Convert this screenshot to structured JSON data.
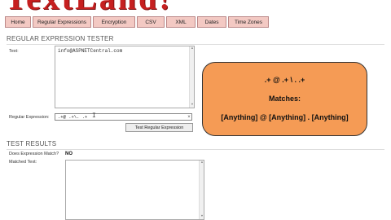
{
  "logo": {
    "text": "TextLand!"
  },
  "nav": [
    "Home",
    "Regular Expressions",
    "Encryption",
    "CSV",
    "XML",
    "Dates",
    "Time Zones"
  ],
  "tester": {
    "title": "REGULAR EXPRESSION TESTER",
    "text_label": "Text:",
    "text_value": "info@ASPNETCentral.com",
    "regex_label": "Regular Expression:",
    "regex_value": ".+@ .+\\. .+",
    "clear_glyph": "×",
    "test_button": "Test Regular Expression"
  },
  "explain": {
    "pattern": ".+ @ .+ \\ . .+",
    "matches_label": "Matches:",
    "description": "[Anything] @ [Anything] . [Anything]",
    "fill_color": "#f59b55"
  },
  "results": {
    "title": "TEST RESULTS",
    "does_match_label": "Does Expression Match?",
    "does_match_value": "NO",
    "matched_text_label": "Matched Text:",
    "matched_text_value": ""
  }
}
